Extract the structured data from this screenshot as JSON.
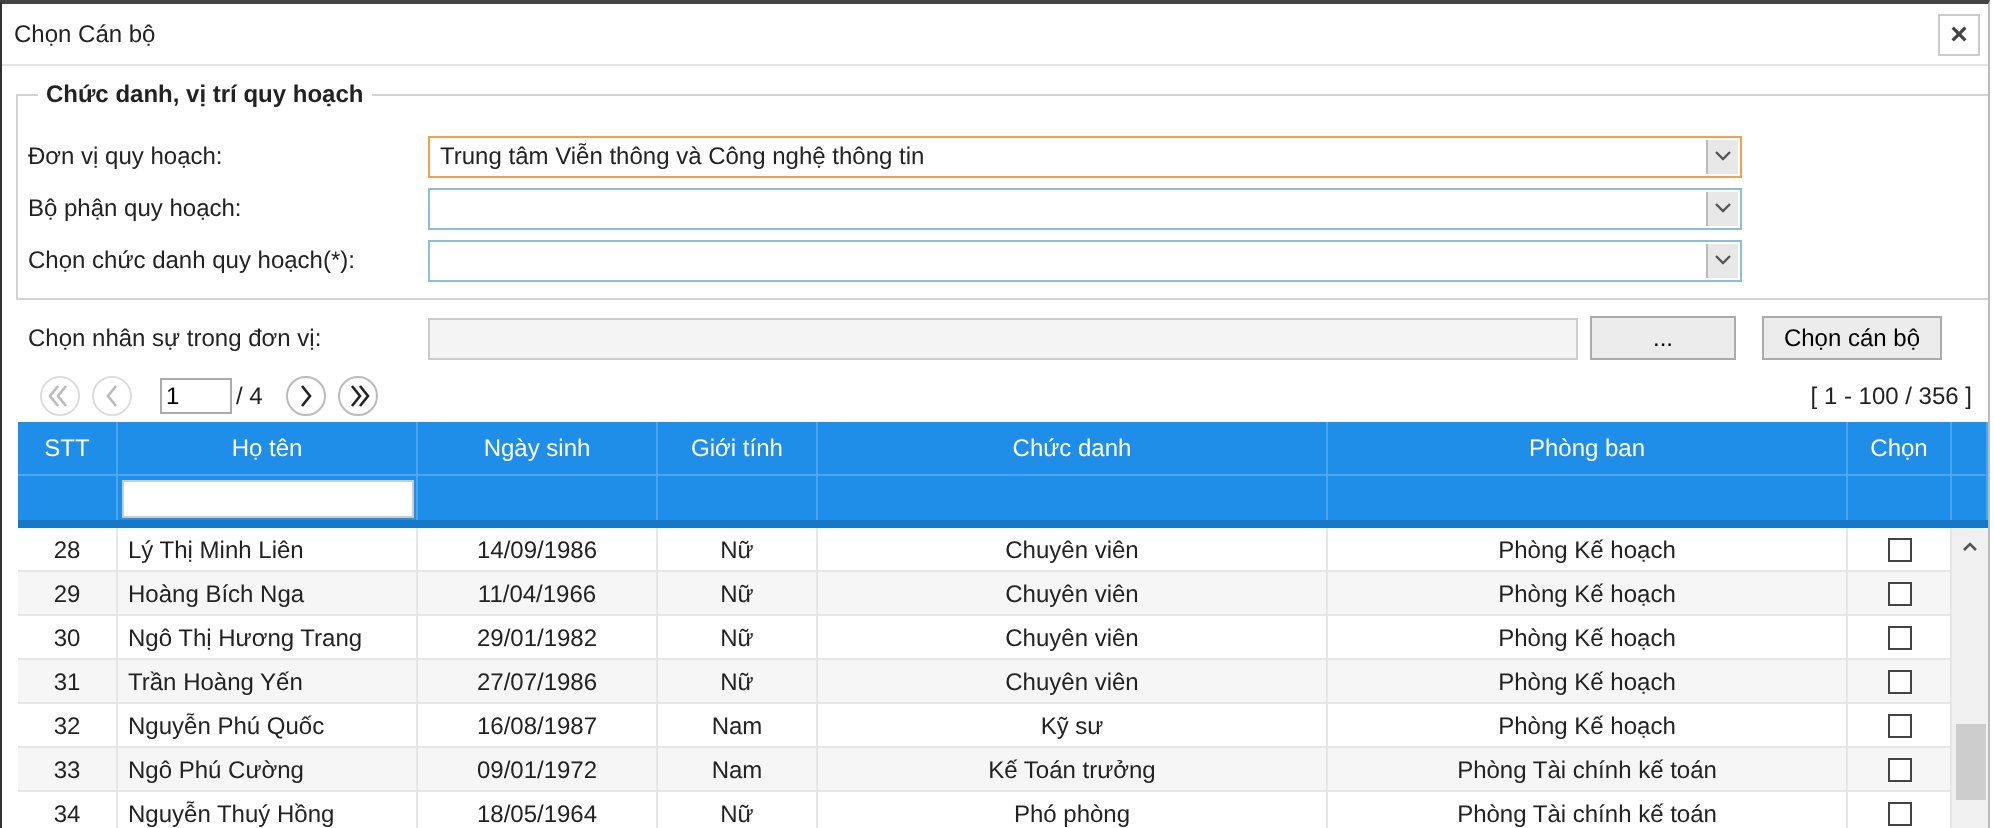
{
  "window": {
    "title": "Chọn Cán bộ",
    "close": "×"
  },
  "planning": {
    "legend": "Chức danh, vị trí quy hoạch",
    "fields": [
      {
        "label": "Đơn vị quy hoạch:",
        "value": "Trung tâm Viễn thông và Công nghệ thông tin",
        "focused": true
      },
      {
        "label": "Bộ phận quy hoạch:",
        "focused": false
      },
      {
        "label": "Chọn chức danh quy hoạch(*):",
        "focused": false
      }
    ]
  },
  "staff_picker": {
    "label": "Chọn nhân sự trong đơn vị:",
    "browse_button": "...",
    "select_button": "Chọn cán bộ"
  },
  "pager": {
    "page": "1",
    "total": "/ 4",
    "range": "[ 1 - 100 / 356 ]"
  },
  "table": {
    "columns": [
      "STT",
      "Họ tên",
      "Ngày sinh",
      "Giới tính",
      "Chức danh",
      "Phòng ban",
      "Chọn"
    ],
    "rows": [
      {
        "stt": "28",
        "name": "Lý Thị Minh Liên",
        "birth": "14/09/1986",
        "gender": "Nữ",
        "title": "Chuyên viên",
        "dept": "Phòng Kế hoạch",
        "checked": false
      },
      {
        "stt": "29",
        "name": "Hoàng Bích Nga",
        "birth": "11/04/1966",
        "gender": "Nữ",
        "title": "Chuyên viên",
        "dept": "Phòng Kế hoạch",
        "checked": false
      },
      {
        "stt": "30",
        "name": "Ngô Thị Hương Trang",
        "birth": "29/01/1982",
        "gender": "Nữ",
        "title": "Chuyên viên",
        "dept": "Phòng Kế hoạch",
        "checked": false
      },
      {
        "stt": "31",
        "name": "Trần Hoàng Yến",
        "birth": "27/07/1986",
        "gender": "Nữ",
        "title": "Chuyên viên",
        "dept": "Phòng Kế hoạch",
        "checked": false
      },
      {
        "stt": "32",
        "name": "Nguyễn Phú Quốc",
        "birth": "16/08/1987",
        "gender": "Nam",
        "title": "Kỹ sư",
        "dept": "Phòng Kế hoạch",
        "checked": false
      },
      {
        "stt": "33",
        "name": "Ngô Phú Cường",
        "birth": "09/01/1972",
        "gender": "Nam",
        "title": "Kế Toán trưởng",
        "dept": "Phòng Tài chính kế toán",
        "checked": false
      },
      {
        "stt": "34",
        "name": "Nguyễn Thuý Hồng",
        "birth": "18/05/1964",
        "gender": "Nữ",
        "title": "Phó phòng",
        "dept": "Phòng Tài chính kế toán",
        "checked": false
      }
    ]
  }
}
